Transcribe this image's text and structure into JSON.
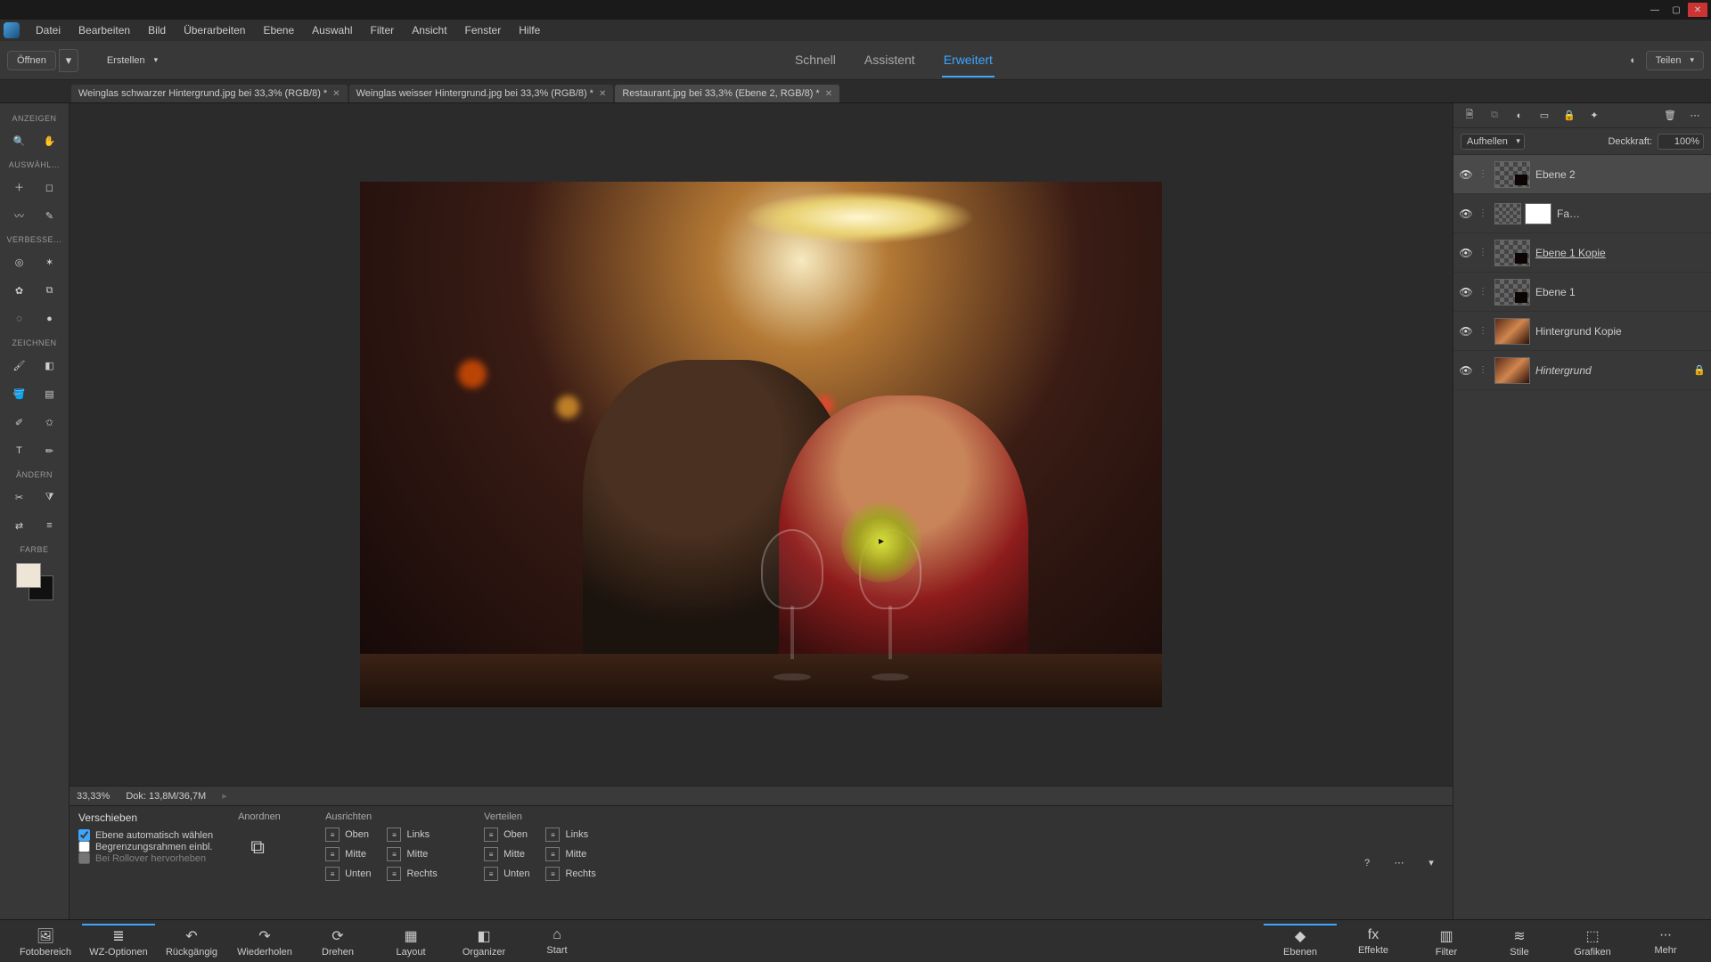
{
  "window_controls": {
    "min": "—",
    "max": "▢",
    "close": "✕"
  },
  "menu": [
    "Datei",
    "Bearbeiten",
    "Bild",
    "Überarbeiten",
    "Ebene",
    "Auswahl",
    "Filter",
    "Ansicht",
    "Fenster",
    "Hilfe"
  ],
  "modebar": {
    "open_label": "Öffnen",
    "create_label": "Erstellen",
    "modes": [
      "Schnell",
      "Assistent",
      "Erweitert"
    ],
    "active_mode": 2,
    "share_label": "Teilen"
  },
  "doc_tabs": [
    {
      "label": "Weinglas schwarzer Hintergrund.jpg bei 33,3% (RGB/8) *",
      "active": false
    },
    {
      "label": "Weinglas weisser Hintergrund.jpg bei 33,3% (RGB/8) *",
      "active": false
    },
    {
      "label": "Restaurant.jpg bei 33,3% (Ebene 2, RGB/8) *",
      "active": true
    }
  ],
  "toolbox": {
    "groups": [
      {
        "head": "ANZEIGEN",
        "rows": [
          [
            "zoom",
            "hand"
          ]
        ]
      },
      {
        "head": "AUSWÄHL…",
        "rows": [
          [
            "move",
            "marquee"
          ],
          [
            "lasso",
            "quick-select"
          ]
        ]
      },
      {
        "head": "VERBESSE…",
        "rows": [
          [
            "eye-tool",
            "heal"
          ],
          [
            "smart-brush",
            "clone"
          ],
          [
            "blur-tool",
            "sponge"
          ]
        ]
      },
      {
        "head": "ZEICHNEN",
        "rows": [
          [
            "brush",
            "eraser"
          ],
          [
            "fill",
            "gradient"
          ],
          [
            "picker",
            "shape"
          ],
          [
            "type",
            "pencil"
          ]
        ]
      },
      {
        "head": "ÄNDERN",
        "rows": [
          [
            "crop",
            "recompose"
          ],
          [
            "move-content",
            "straighten"
          ]
        ]
      },
      {
        "head": "FARBE",
        "rows": []
      }
    ]
  },
  "status": {
    "zoom": "33,33%",
    "doc_size": "Dok: 13,8M/36,7M"
  },
  "layers_panel": {
    "blend_mode": "Aufhellen",
    "opacity_label": "Deckkraft:",
    "opacity_value": "100%",
    "layers": [
      {
        "name": "Ebene 2",
        "selected": true,
        "checker": true,
        "mini": true
      },
      {
        "name": "Fa…",
        "adjust": true,
        "mask": true
      },
      {
        "name": "Ebene 1 Kopie",
        "checker": true,
        "mini": true,
        "underline": true
      },
      {
        "name": "Ebene 1",
        "checker": true,
        "mini": true
      },
      {
        "name": "Hintergrund Kopie",
        "photo": true
      },
      {
        "name": "Hintergrund",
        "photo": true,
        "italic": true,
        "locked": true
      }
    ]
  },
  "tool_options": {
    "title": "Verschieben",
    "checks": [
      {
        "label": "Ebene automatisch wählen",
        "checked": true
      },
      {
        "label": "Begrenzungsrahmen einbl.",
        "checked": false
      },
      {
        "label": "Bei Rollover hervorheben",
        "checked": false,
        "disabled": true
      }
    ],
    "arrange_head": "Anordnen",
    "align_head": "Ausrichten",
    "distribute_head": "Verteilen",
    "align_cols": [
      [
        "Oben",
        "Mitte",
        "Unten"
      ],
      [
        "Links",
        "Mitte",
        "Rechts"
      ]
    ]
  },
  "bottom_left": [
    {
      "icon": "🖼",
      "label": "Fotobereich"
    },
    {
      "icon": "≣",
      "label": "WZ-Optionen",
      "active": true
    },
    {
      "icon": "↶",
      "label": "Rückgängig"
    },
    {
      "icon": "↷",
      "label": "Wiederholen"
    },
    {
      "icon": "⟳",
      "label": "Drehen"
    },
    {
      "icon": "▦",
      "label": "Layout"
    },
    {
      "icon": "◧",
      "label": "Organizer"
    },
    {
      "icon": "⌂",
      "label": "Start"
    }
  ],
  "bottom_right": [
    {
      "icon": "◆",
      "label": "Ebenen",
      "active": true
    },
    {
      "icon": "fx",
      "label": "Effekte"
    },
    {
      "icon": "▥",
      "label": "Filter"
    },
    {
      "icon": "≋",
      "label": "Stile"
    },
    {
      "icon": "⬚",
      "label": "Grafiken"
    },
    {
      "icon": "∙∙∙",
      "label": "Mehr"
    }
  ]
}
